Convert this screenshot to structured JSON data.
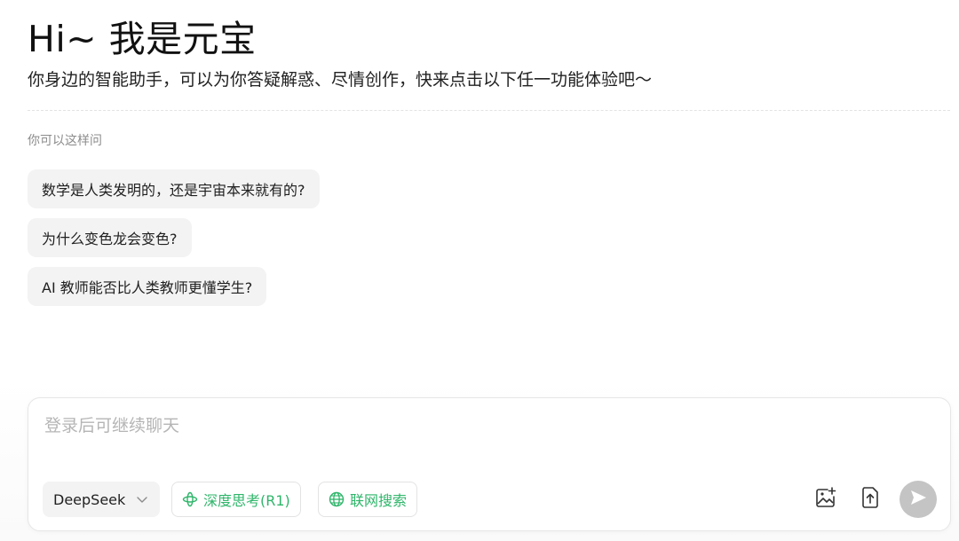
{
  "hero": {
    "title": "Hi~ 我是元宝",
    "subtitle": "你身边的智能助手，可以为你答疑解惑、尽情创作，快来点击以下任一功能体验吧～"
  },
  "suggestions": {
    "label": "你可以这样问",
    "items": [
      "数学是人类发明的，还是宇宙本来就有的?",
      "为什么变色龙会变色?",
      "AI 教师能否比人类教师更懂学生?"
    ]
  },
  "composer": {
    "placeholder": "登录后可继续聊天",
    "model": {
      "selected": "DeepSeek",
      "icon": "chevron-down-icon"
    },
    "deep_think": {
      "label": "深度思考(R1)",
      "icon": "atom-icon"
    },
    "web_search": {
      "label": "联网搜索",
      "icon": "globe-icon"
    },
    "tools": [
      {
        "name": "image-add-icon"
      },
      {
        "name": "file-upload-icon"
      }
    ],
    "send": {
      "icon": "send-icon"
    }
  },
  "colors": {
    "accent_green": "#2fb56a",
    "chip_bg": "#f3f3f3",
    "send_disabled": "#c4c4c4",
    "placeholder": "#b5b5b5"
  }
}
